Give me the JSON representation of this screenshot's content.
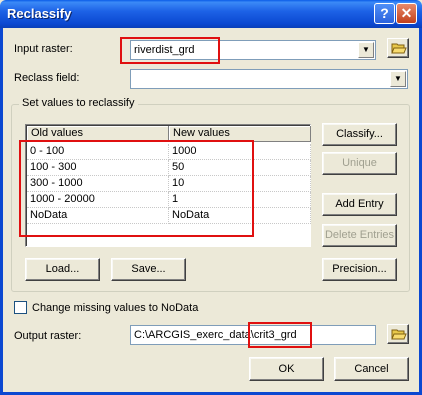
{
  "window": {
    "title": "Reclassify",
    "help_glyph": "?",
    "close_glyph": "✕"
  },
  "input_raster": {
    "label": "Input raster:",
    "value": "riverdist_grd"
  },
  "reclass_field": {
    "label": "Reclass field:",
    "value": ""
  },
  "group": {
    "legend": "Set values to reclassify"
  },
  "table": {
    "headers": [
      "Old values",
      "New values"
    ],
    "rows": [
      {
        "old": "0 - 100",
        "new": "1000"
      },
      {
        "old": "100 - 300",
        "new": "50"
      },
      {
        "old": "300 - 1000",
        "new": "10"
      },
      {
        "old": "1000 - 20000",
        "new": "1"
      },
      {
        "old": "NoData",
        "new": "NoData"
      }
    ]
  },
  "side_buttons": {
    "classify": "Classify...",
    "unique": "Unique",
    "add_entry": "Add Entry",
    "delete_entries": "Delete Entries",
    "precision": "Precision..."
  },
  "bottom_buttons": {
    "load": "Load...",
    "save": "Save..."
  },
  "missing": {
    "label": "Change missing values to NoData",
    "checked": false
  },
  "output_raster": {
    "label": "Output raster:",
    "value_prefix": "C:\\ARCGIS_exerc_data\\",
    "value_name": "crit3_grd"
  },
  "dialog_buttons": {
    "ok": "OK",
    "cancel": "Cancel"
  },
  "colors": {
    "titlebar": "#0b48d1",
    "highlight": "#e01010",
    "dialog_bg": "#ece9d8"
  },
  "icons": [
    "help-icon",
    "close-icon",
    "folder-open-icon",
    "chevron-down-icon"
  ]
}
